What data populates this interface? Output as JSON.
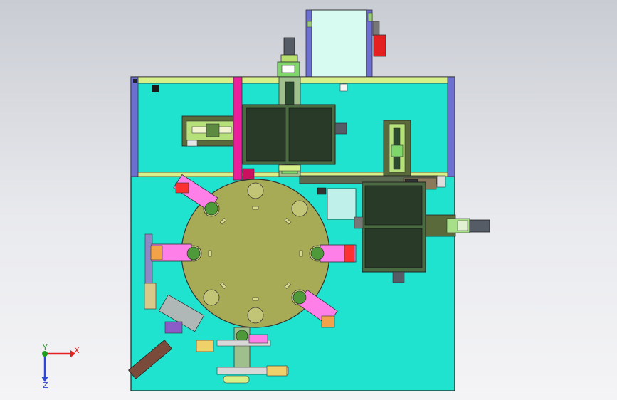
{
  "viewport": {
    "background_top": "#c9ccd3",
    "background_bottom": "#f4f4f6"
  },
  "colors": {
    "base_plate": "#1fe3cf",
    "rotary_table": "#a8ab55",
    "rail_yellow": "#d8f08a",
    "magenta_column": "#ec1e9b",
    "pink_block": "#ff7fe8",
    "tray_dark": "#3d5a3a",
    "frame_blue": "#6d6fd1",
    "red_block": "#e52020",
    "axis_red": "#e52020",
    "axis_green": "#1e9e1e",
    "axis_blue": "#2e46d6"
  },
  "triad": {
    "x_label": "X",
    "z_label": "Z",
    "y_label": "Y"
  }
}
